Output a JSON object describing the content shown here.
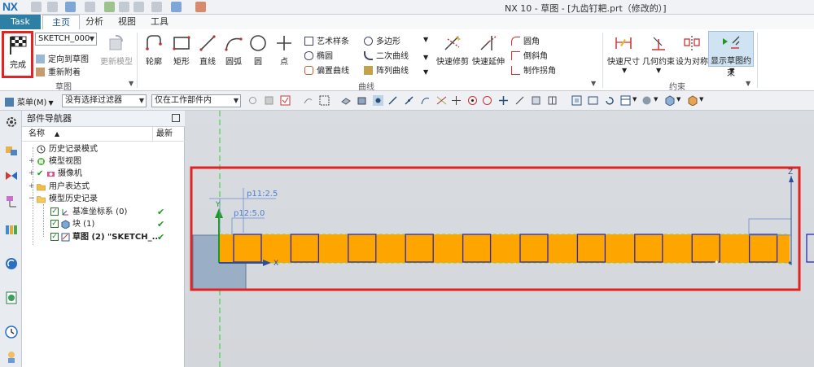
{
  "app": {
    "logo": "NX",
    "window_title": "NX 10 - 草图 - [九齿钉耙.prt（修改的）]"
  },
  "tabs": {
    "task": "Task",
    "home": "主页",
    "analysis": "分析",
    "view": "视图",
    "tools": "工具"
  },
  "ribbon": {
    "sketch_group": {
      "finish": "完成",
      "sketch_name": "SKETCH_000",
      "orient_to_sketch": "定向到草图",
      "reattach": "重新附着",
      "update_model": "更新模型",
      "label": "草图"
    },
    "curve_group": {
      "profile": "轮廓",
      "rectangle": "矩形",
      "line": "直线",
      "arc": "圆弧",
      "circle": "圆",
      "point": "点",
      "studio_spline": "艺术样条",
      "ellipse": "椭圆",
      "offset_curve": "偏置曲线",
      "polygon": "多边形",
      "conic": "二次曲线",
      "pattern_curve": "阵列曲线",
      "quick_trim": "快速修剪",
      "quick_extend": "快速延伸",
      "fillet": "圆角",
      "chamfer": "倒斜角",
      "make_corner": "制作拐角",
      "label": "曲线"
    },
    "constraint_group": {
      "rapid_dimension": "快速尺寸",
      "geometric_constraints": "几何约束",
      "make_symmetric": "设为对称",
      "display_constraints": "显示草图约束",
      "label": "约束"
    }
  },
  "selection_bar": {
    "menu": "菜单(M)",
    "filter": "没有选择过滤器",
    "scope": "仅在工作部件内"
  },
  "navigator": {
    "title": "部件导航器",
    "col_name": "名称",
    "col_latest": "最新",
    "items": [
      {
        "label": "历史记录模式"
      },
      {
        "label": "模型视图"
      },
      {
        "label": "摄像机"
      },
      {
        "label": "用户表达式"
      },
      {
        "label": "模型历史记录"
      },
      {
        "label": "基准坐标系 (0)"
      },
      {
        "label": "块 (1)"
      },
      {
        "label": "草图 (2) \"SKETCH_..."
      }
    ]
  },
  "sketch": {
    "dim1": "p11:2.5",
    "dim2": "p12:5.0",
    "axis_x": "X",
    "axis_y": "Y",
    "axis_z": "Z",
    "square_count": 12,
    "fill_color": "#ffa500",
    "outline_color": "#2b2bb5",
    "highlight_color": "#e02424"
  }
}
